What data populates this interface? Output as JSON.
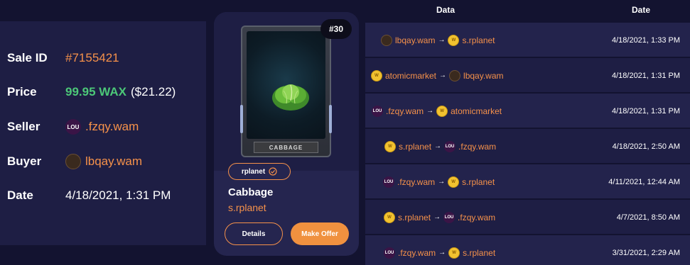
{
  "sale": {
    "sale_id_label": "Sale ID",
    "sale_id": "#7155421",
    "price_label": "Price",
    "price_wax": "99.95 WAX",
    "price_usd": "($21.22)",
    "seller_label": "Seller",
    "seller": ".fzqy.wam",
    "seller_avatar": "LOU",
    "buyer_label": "Buyer",
    "buyer": "lbqay.wam",
    "date_label": "Date",
    "date": "4/18/2021, 1:31 PM"
  },
  "card": {
    "mint": "#30",
    "nft_label": "CABBAGE",
    "collection": "rplanet",
    "title": "Cabbage",
    "schema": "s.rplanet",
    "details_label": "Details",
    "offer_label": "Make Offer"
  },
  "table": {
    "col_data": "Data",
    "col_date": "Date",
    "rows": [
      {
        "from": "lbqay.wam",
        "from_icon": "lbqay-avatar-icon",
        "to": "s.rplanet",
        "to_icon": "wax-coin-icon",
        "date": "4/18/2021, 1:33 PM"
      },
      {
        "from": "atomicmarket",
        "from_icon": "wax-coin-icon",
        "to": "lbqay.wam",
        "to_icon": "lbqay-avatar-icon",
        "date": "4/18/2021, 1:31 PM"
      },
      {
        "from": ".fzqy.wam",
        "from_icon": "lou-avatar-icon",
        "to": "atomicmarket",
        "to_icon": "wax-coin-icon",
        "date": "4/18/2021, 1:31 PM"
      },
      {
        "from": "s.rplanet",
        "from_icon": "wax-coin-icon",
        "to": ".fzqy.wam",
        "to_icon": "lou-avatar-icon",
        "date": "4/18/2021, 2:50 AM"
      },
      {
        "from": ".fzqy.wam",
        "from_icon": "lou-avatar-icon",
        "to": "s.rplanet",
        "to_icon": "wax-coin-icon",
        "date": "4/11/2021, 12:44 AM"
      },
      {
        "from": "s.rplanet",
        "from_icon": "wax-coin-icon",
        "to": ".fzqy.wam",
        "to_icon": "lou-avatar-icon",
        "date": "4/7/2021, 8:50 AM"
      },
      {
        "from": ".fzqy.wam",
        "from_icon": "lou-avatar-icon",
        "to": "s.rplanet",
        "to_icon": "wax-coin-icon",
        "date": "3/31/2021, 2:29 AM"
      }
    ]
  },
  "colors": {
    "background": "#131330",
    "panel": "#1e1e44",
    "accent_orange": "#f5914a",
    "price_green": "#4cc878"
  }
}
